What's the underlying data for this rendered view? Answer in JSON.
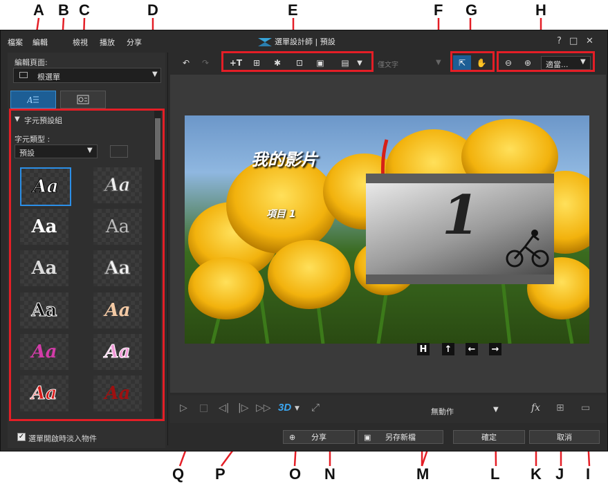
{
  "callouts": {
    "top": [
      "A",
      "B",
      "C",
      "D",
      "E",
      "F",
      "G",
      "H"
    ],
    "bottom": [
      "Q",
      "P",
      "O",
      "N",
      "M",
      "L",
      "K",
      "J",
      "I"
    ]
  },
  "menu": {
    "file": "檔案",
    "edit": "編輯",
    "view": "檢視",
    "play": "播放",
    "share": "分享"
  },
  "window": {
    "title": "選單設計師 | 預設",
    "help": "?",
    "maximize": "□",
    "close": "✕"
  },
  "left": {
    "edit_page_label": "編輯頁面:",
    "edit_page_value": "根選單",
    "section_title": "字元預設組",
    "char_type_label": "字元類型 :",
    "char_type_value": "預設",
    "fade_checkbox_label": "選單開啟時淡入物件",
    "tile_text": "Aa"
  },
  "toolbar": {
    "text_mode_placeholder": "僅文字",
    "zoom_value": "適當..."
  },
  "preview": {
    "title_text": "我的影片",
    "item_text": "項目 1",
    "thumb_number": "1",
    "nav_h": "H",
    "nav_up": "↑",
    "nav_left": "←",
    "nav_right": "→"
  },
  "playback": {
    "mode_3d": "3D",
    "motion_value": "無動作",
    "fx_label": "fx"
  },
  "buttons": {
    "share": "分享",
    "save_as_new": "另存新檔",
    "ok": "確定",
    "cancel": "取消"
  },
  "colors": {
    "accent_red": "#e41e26",
    "selection_blue": "#2b8fe8",
    "app_bg": "#2b2b2b"
  }
}
